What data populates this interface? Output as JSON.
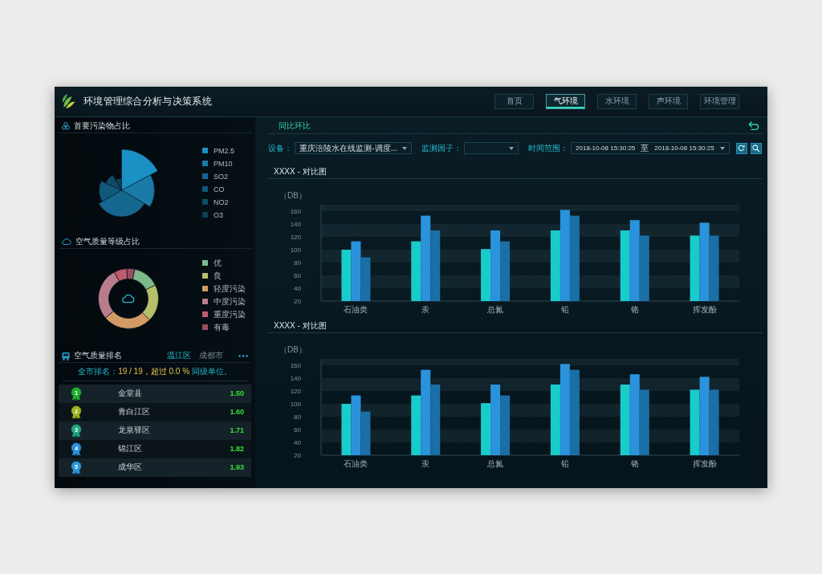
{
  "header": {
    "title": "环境管理综合分析与决策系统",
    "nav": [
      {
        "label": "首页",
        "selected": false
      },
      {
        "label": "气环境",
        "selected": true
      },
      {
        "label": "水环境",
        "selected": false
      },
      {
        "label": "声环境",
        "selected": false
      },
      {
        "label": "环境管理",
        "selected": false
      }
    ]
  },
  "pollutant_share": {
    "title": "首要污染物占比",
    "legend": [
      {
        "label": "PM2.5",
        "color": "#1b90c4"
      },
      {
        "label": "PM10",
        "color": "#1a7aa8"
      },
      {
        "label": "SO2",
        "color": "#15678f"
      },
      {
        "label": "CO",
        "color": "#125878"
      },
      {
        "label": "NO2",
        "color": "#0f4a66"
      },
      {
        "label": "O3",
        "color": "#0d3f57"
      }
    ]
  },
  "air_quality_levels": {
    "title": "空气质量等级占比",
    "legend": [
      {
        "label": "优",
        "color": "#7dba8b"
      },
      {
        "label": "良",
        "color": "#b4c06a"
      },
      {
        "label": "轻度污染",
        "color": "#d29b66"
      },
      {
        "label": "中度污染",
        "color": "#b87c8c"
      },
      {
        "label": "重度污染",
        "color": "#c25a6e"
      },
      {
        "label": "有毒",
        "color": "#9c4f60"
      }
    ]
  },
  "air_quality_ranking": {
    "title": "空气质量排名",
    "tabs": [
      {
        "label": "温江区",
        "selected": true
      },
      {
        "label": "成都市",
        "selected": false
      }
    ],
    "summary": [
      {
        "kind": "label",
        "text": "全市排名："
      },
      {
        "kind": "value",
        "text": "19 / 19，超过 0.0 %"
      },
      {
        "kind": "label",
        "text": " 同级单位。"
      }
    ],
    "rows": [
      {
        "rank": "1",
        "name": "金堂县",
        "value": "1.50",
        "color": "#1fae2a"
      },
      {
        "rank": "2",
        "name": "青白江区",
        "value": "1.60",
        "color": "#9cb21e"
      },
      {
        "rank": "3",
        "name": "龙泉驿区",
        "value": "1.71",
        "color": "#1fa57e"
      },
      {
        "rank": "4",
        "name": "锦江区",
        "value": "1.82",
        "color": "#2a8fd6"
      },
      {
        "rank": "5",
        "name": "成华区",
        "value": "1.93",
        "color": "#2b95dc"
      }
    ]
  },
  "comparison": {
    "title": "同比环比",
    "filters": [
      {
        "kind": "select",
        "label": "设备：",
        "value": "重庆涪陵水在线监测-调度..."
      },
      {
        "kind": "select",
        "label": "监测因子："
      },
      {
        "kind": "date_range",
        "label": "时间范围：",
        "start": "2018-10-08 15:30:25",
        "separator": "至",
        "end": "2018-10-08 15:30:25"
      }
    ],
    "charts": [
      {
        "title": "XXXX - 对比图",
        "chart_data": {
          "type": "bar",
          "ylabel": "（DB）",
          "categories": [
            "石油类",
            "汞",
            "总氮",
            "铅",
            "铬",
            "挥发酚"
          ],
          "series": [
            {
              "color": "#19cccc",
              "values": [
                100,
                113,
                101,
                130,
                130,
                122
              ]
            },
            {
              "color": "#2b93db",
              "values": [
                113,
                153,
                130,
                162,
                146,
                142
              ]
            },
            {
              "color": "#1a6fa6",
              "values": [
                88,
                130,
                113,
                153,
                122,
                122
              ]
            }
          ],
          "ylim": [
            20,
            170
          ],
          "yticks": [
            20,
            40,
            60,
            80,
            100,
            120,
            140,
            160
          ]
        }
      },
      {
        "title": "XXXX - 对比图",
        "chart_data": {
          "type": "bar",
          "ylabel": "（DB）",
          "categories": [
            "石油类",
            "汞",
            "总氮",
            "铅",
            "铬",
            "挥发酚"
          ],
          "series": [
            {
              "color": "#19cccc",
              "values": [
                100,
                113,
                101,
                130,
                130,
                122
              ]
            },
            {
              "color": "#2b93db",
              "values": [
                113,
                153,
                130,
                162,
                146,
                142
              ]
            },
            {
              "color": "#1a6fa6",
              "values": [
                88,
                130,
                113,
                153,
                122,
                122
              ]
            }
          ],
          "ylim": [
            20,
            170
          ],
          "yticks": [
            20,
            40,
            60,
            80,
            100,
            120,
            140,
            160
          ]
        }
      }
    ]
  }
}
